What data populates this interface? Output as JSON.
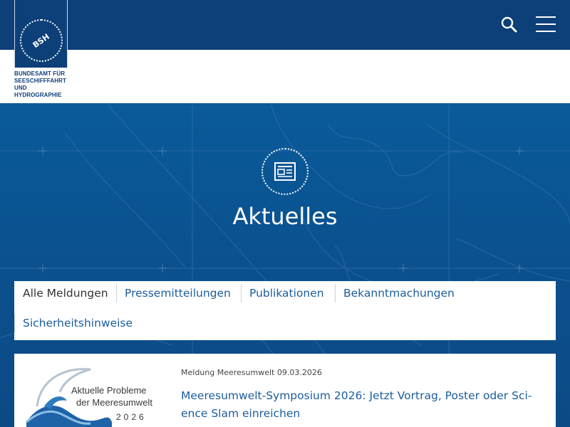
{
  "header": {
    "logo_mark": "BSH",
    "logo_lines": [
      "BUNDESAMT FÜR",
      "SEESCHIFFFAHRT",
      "UND",
      "HYDROGRAPHIE"
    ],
    "search_icon": "search-icon",
    "menu_icon": "hamburger-menu-icon"
  },
  "hero": {
    "icon": "newspaper-icon",
    "title": "Aktuelles"
  },
  "tabs": {
    "items": [
      {
        "label": "Alle Meldungen",
        "active": true
      },
      {
        "label": "Pressemitteilungen",
        "active": false
      },
      {
        "label": "Publikationen",
        "active": false
      },
      {
        "label": "Bekanntmachungen",
        "active": false
      },
      {
        "label": "Sicherheitshinweise",
        "active": false
      }
    ]
  },
  "news": [
    {
      "meta": "Meldung Meeresumwelt 09.03.2026",
      "title_lines": [
        "Meeresumwelt-Symposium 2026: Jetzt Vortrag, Poster oder Sci-",
        "ence Slam einreichen"
      ],
      "image_lines": [
        "Aktuelle Probleme",
        "der Meeresumwelt",
        "2026"
      ]
    }
  ],
  "colors": {
    "header_dark": "#0d3f78",
    "hero_blue": "#0b4f8c",
    "link_blue": "#1b5d9c",
    "text_dark": "#333333"
  }
}
